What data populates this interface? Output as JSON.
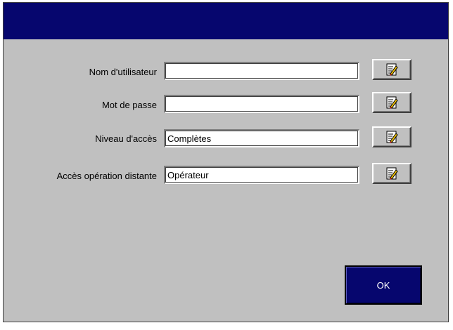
{
  "window": {
    "title": "",
    "titlebar_color": "#06066e",
    "background_color": "#c0c0c0"
  },
  "form": {
    "fields": [
      {
        "label": "Nom d'utilisateur",
        "value": "",
        "edit_icon": "edit-note-icon"
      },
      {
        "label": "Mot de passe",
        "value": "",
        "edit_icon": "edit-note-icon"
      },
      {
        "label": "Niveau d'accès",
        "value": "Complètes",
        "edit_icon": "edit-note-icon"
      },
      {
        "label": "Accès opération distante",
        "value": "Opérateur",
        "edit_icon": "edit-note-icon"
      }
    ]
  },
  "buttons": {
    "ok_label": "OK",
    "ok_color": "#06066e"
  }
}
